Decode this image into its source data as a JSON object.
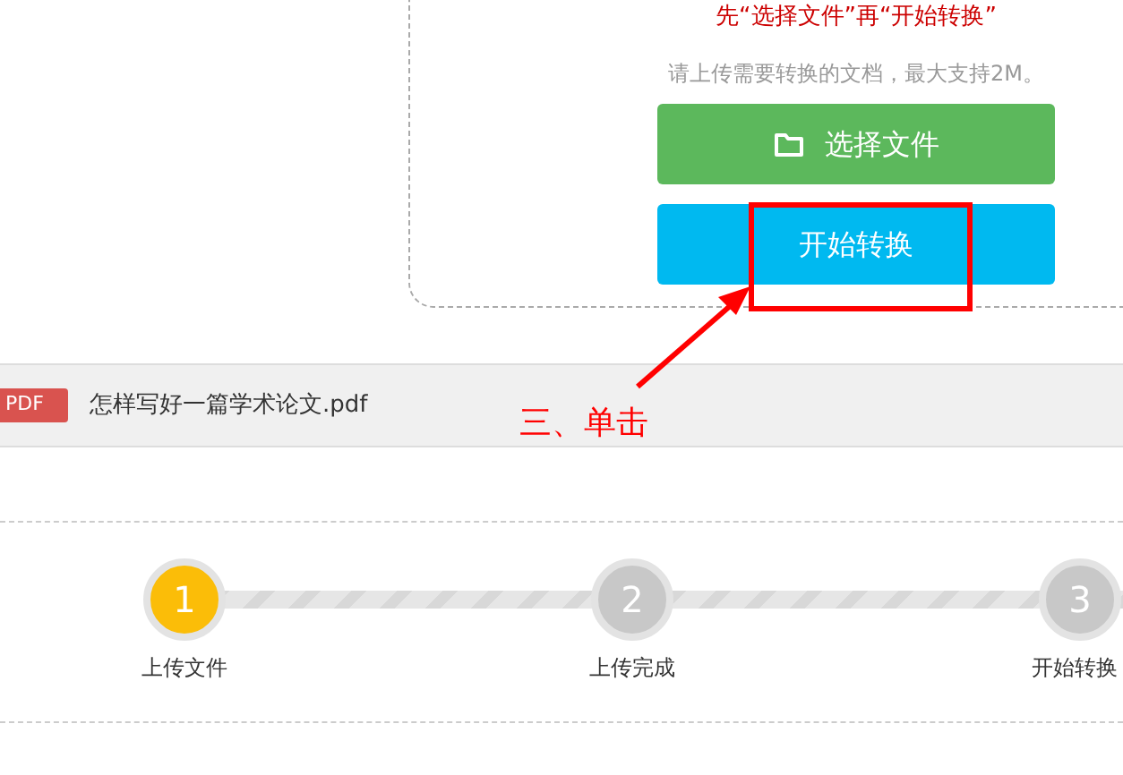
{
  "upload_panel": {
    "instruction": "先“选择文件”再“开始转换”",
    "hint": "请上传需要转换的文档，最大支持2M。",
    "choose_button": "选择文件",
    "convert_button": "开始转换"
  },
  "file": {
    "badge": "PDF",
    "name": "怎样写好一篇学术论文.pdf"
  },
  "annotation": {
    "text": "三、单击"
  },
  "steps": [
    {
      "number": "1",
      "label": "上传文件",
      "active": true
    },
    {
      "number": "2",
      "label": "上传完成",
      "active": false
    },
    {
      "number": "3",
      "label": "开始转换",
      "active": false
    }
  ]
}
